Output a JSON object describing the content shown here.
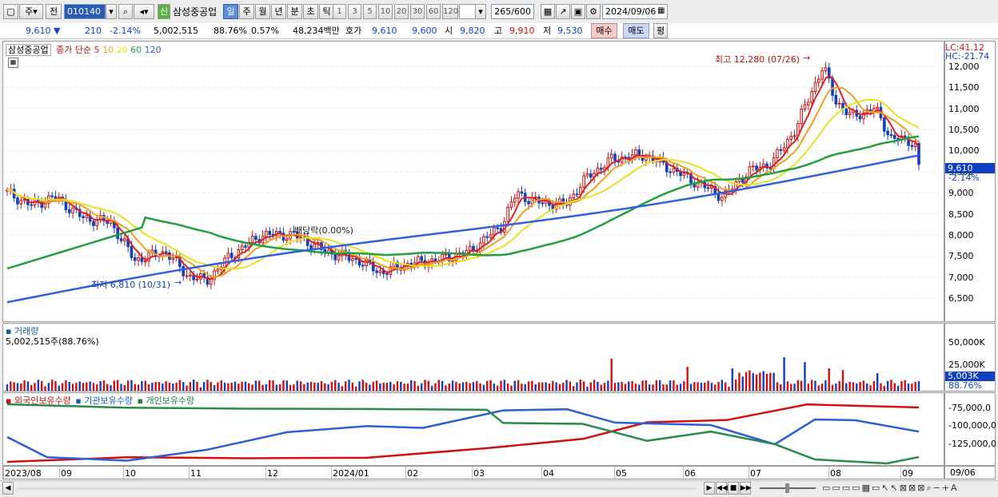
{
  "toolbar": {
    "market": "주",
    "prev": "전",
    "code": "010140",
    "badge": "신",
    "name": "삼성중공업",
    "periods": [
      "일",
      "주",
      "월",
      "년",
      "분",
      "초",
      "틱"
    ],
    "active_period": "일",
    "intervals": [
      "1",
      "3",
      "5",
      "10",
      "20",
      "30",
      "60",
      "120"
    ],
    "count": "265",
    "count_total": "/600",
    "date": "2024/09/06"
  },
  "quote": {
    "price": "9,610",
    "direction": "▼",
    "change": "210",
    "change_pct": "-2.14%",
    "volume": "5,002,515",
    "volume_ratio": "88.76%",
    "turnover_pct": "0.57%",
    "amount": "48,234백만",
    "hoga_label": "호가",
    "ask": "9,610",
    "bid": "9,600",
    "open_label": "시",
    "open": "9,820",
    "high_label": "고",
    "high": "9,910",
    "low_label": "저",
    "low": "9,530",
    "buy_label": "매수",
    "sell_label": "매도",
    "avg_label": "평"
  },
  "price_pane": {
    "title": "삼성중공업",
    "legend": "종가 단순",
    "ma": [
      {
        "label": "5",
        "color": "#e02020"
      },
      {
        "label": "10",
        "color": "#f0a020"
      },
      {
        "label": "20",
        "color": "#e8e020"
      },
      {
        "label": "60",
        "color": "#20a040"
      },
      {
        "label": "120",
        "color": "#3060e0"
      }
    ],
    "lc": "LC:41.12",
    "hc": "HC:-21.74",
    "y_ticks": [
      "12,000",
      "11,500",
      "11,000",
      "10,500",
      "10,000",
      "9,500",
      "9,000",
      "8,500",
      "8,000",
      "7,500",
      "7,000",
      "6,500"
    ],
    "current_price": "9,610",
    "current_pct": "-2.14%",
    "high_note": "최고 12,280 (07/26)",
    "low_note": "최저 6,810 (10/31)",
    "dividend_note": "배당락(0.00%)"
  },
  "volume_pane": {
    "title": "거래량",
    "value": "5,002,515주(88.76%)",
    "y_ticks": [
      "50,000K",
      "25,000K"
    ],
    "current": "5,003K",
    "current_pct": "88.76%"
  },
  "holding_pane": {
    "series": [
      {
        "name": "외국인보유수량",
        "color": "#d01010"
      },
      {
        "name": "기관보유수량",
        "color": "#1060c0"
      },
      {
        "name": "개인보유수량",
        "color": "#208040"
      }
    ],
    "y_ticks": [
      "-75,000,0",
      "-100,000,0",
      "-125,000,0"
    ]
  },
  "x_axis": {
    "labels": [
      "2023/08",
      "09",
      "10",
      "11",
      "12",
      "2024/01",
      "02",
      "03",
      "04",
      "05",
      "06",
      "07",
      "08",
      "09"
    ],
    "end_date": "09/06"
  },
  "chart_data": {
    "type": "candlestick",
    "symbol": "삼성중공업",
    "monthly_close_approx": [
      {
        "month": "2023/08",
        "value": 8900
      },
      {
        "month": "09",
        "value": 8200
      },
      {
        "month": "10",
        "value": 7000
      },
      {
        "month": "11",
        "value": 7600
      },
      {
        "month": "12",
        "value": 7800
      },
      {
        "month": "2024/01",
        "value": 7200
      },
      {
        "month": "02",
        "value": 7300
      },
      {
        "month": "03",
        "value": 8800
      },
      {
        "month": "04",
        "value": 9800
      },
      {
        "month": "05",
        "value": 9700
      },
      {
        "month": "06",
        "value": 8900
      },
      {
        "month": "07",
        "value": 11500
      },
      {
        "month": "08",
        "value": 10700
      },
      {
        "month": "09",
        "value": 9610
      }
    ],
    "ylim": [
      6300,
      12400
    ],
    "high": 12280,
    "high_date": "07/26",
    "low": 6810,
    "low_date": "10/31"
  }
}
